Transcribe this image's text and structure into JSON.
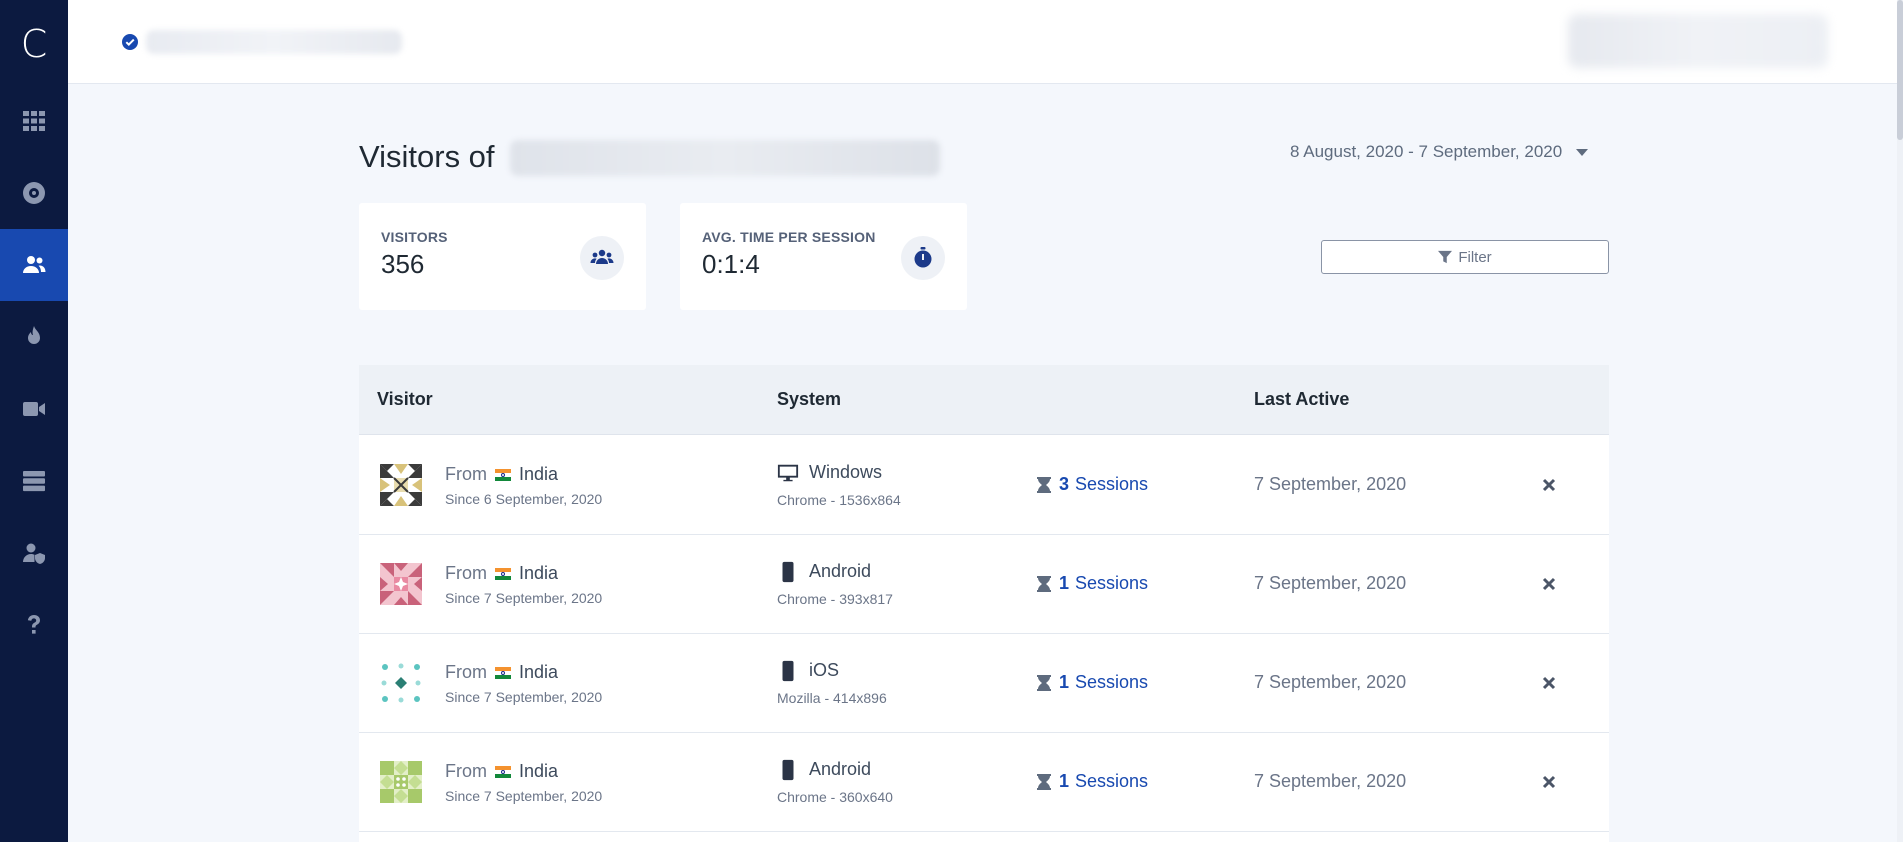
{
  "app": {
    "logo_letter": "C"
  },
  "sidebar": {
    "items": [
      {
        "name": "dashboard",
        "icon": "grid-icon",
        "active": false
      },
      {
        "name": "sites",
        "icon": "target-icon",
        "active": false
      },
      {
        "name": "visitors",
        "icon": "users-icon",
        "active": true
      },
      {
        "name": "heatmaps",
        "icon": "fire-icon",
        "active": false
      },
      {
        "name": "recordings",
        "icon": "video-camera-icon",
        "active": false
      },
      {
        "name": "server",
        "icon": "server-icon",
        "active": false
      },
      {
        "name": "user-privacy",
        "icon": "user-shield-icon",
        "active": false
      },
      {
        "name": "help",
        "icon": "question-icon",
        "active": false
      }
    ]
  },
  "header": {
    "title_prefix": "Visitors of",
    "date_range": "8 August, 2020 - 7 September, 2020"
  },
  "stats": {
    "visitors": {
      "label": "VISITORS",
      "value": "356",
      "icon": "users-icon"
    },
    "avg_time": {
      "label": "AVG. TIME PER SESSION",
      "value": "0:1:4",
      "icon": "stopwatch-icon"
    }
  },
  "filter": {
    "label": "Filter"
  },
  "table": {
    "columns": {
      "visitor": "Visitor",
      "system": "System",
      "last_active": "Last Active"
    },
    "rows": [
      {
        "from_label": "From",
        "country": "India",
        "since": "Since 6 September, 2020",
        "device_icon": "desktop-icon",
        "os": "Windows",
        "browser": "Chrome - 1536x864",
        "session_count": "3",
        "session_label": "Sessions",
        "last_active": "7 September, 2020",
        "avatar_colors": [
          "#3b3b3b",
          "#d8c27a"
        ]
      },
      {
        "from_label": "From",
        "country": "India",
        "since": "Since 7 September, 2020",
        "device_icon": "mobile-icon",
        "os": "Android",
        "browser": "Chrome - 393x817",
        "session_count": "1",
        "session_label": "Sessions",
        "last_active": "7 September, 2020",
        "avatar_colors": [
          "#c9627a",
          "#f3c5cf"
        ]
      },
      {
        "from_label": "From",
        "country": "India",
        "since": "Since 7 September, 2020",
        "device_icon": "mobile-icon",
        "os": "iOS",
        "browser": "Mozilla - 414x896",
        "session_count": "1",
        "session_label": "Sessions",
        "last_active": "7 September, 2020",
        "avatar_colors": [
          "#5bc4c0",
          "#2a7f74"
        ]
      },
      {
        "from_label": "From",
        "country": "India",
        "since": "Since 7 September, 2020",
        "device_icon": "mobile-icon",
        "os": "Android",
        "browser": "Chrome - 360x640",
        "session_count": "1",
        "session_label": "Sessions",
        "last_active": "7 September, 2020",
        "avatar_colors": [
          "#a7c96a",
          "#e3efc8"
        ]
      }
    ]
  }
}
